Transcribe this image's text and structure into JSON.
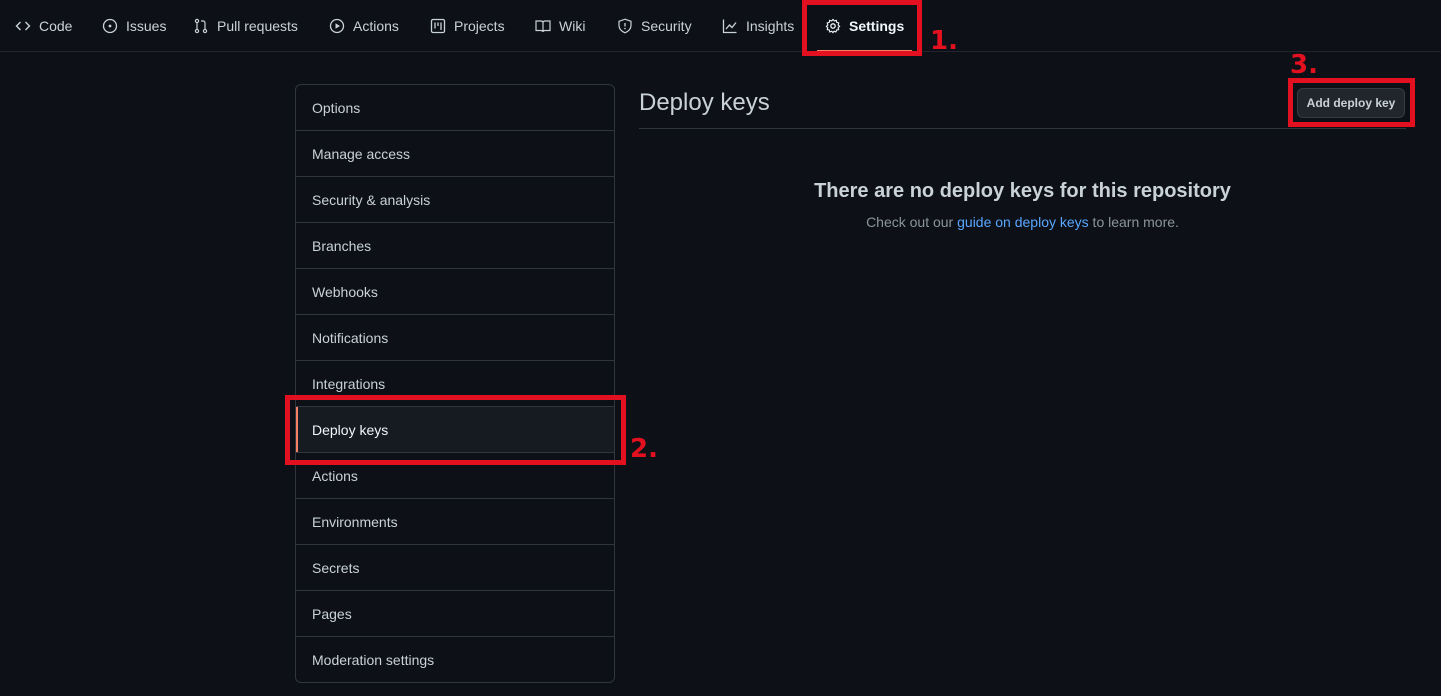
{
  "repo_nav": {
    "tabs": [
      {
        "label": "Code",
        "icon": "code-icon"
      },
      {
        "label": "Issues",
        "icon": "issue-opened-icon"
      },
      {
        "label": "Pull requests",
        "icon": "git-pull-request-icon"
      },
      {
        "label": "Actions",
        "icon": "play-icon"
      },
      {
        "label": "Projects",
        "icon": "project-icon"
      },
      {
        "label": "Wiki",
        "icon": "book-icon"
      },
      {
        "label": "Security",
        "icon": "shield-icon"
      },
      {
        "label": "Insights",
        "icon": "graph-icon"
      },
      {
        "label": "Settings",
        "icon": "gear-icon",
        "active": true
      }
    ]
  },
  "settings_menu": {
    "items": [
      {
        "label": "Options"
      },
      {
        "label": "Manage access"
      },
      {
        "label": "Security & analysis"
      },
      {
        "label": "Branches"
      },
      {
        "label": "Webhooks"
      },
      {
        "label": "Notifications"
      },
      {
        "label": "Integrations"
      },
      {
        "label": "Deploy keys",
        "selected": true
      },
      {
        "label": "Actions"
      },
      {
        "label": "Environments"
      },
      {
        "label": "Secrets"
      },
      {
        "label": "Pages"
      },
      {
        "label": "Moderation settings"
      }
    ]
  },
  "main": {
    "title": "Deploy keys",
    "add_button_label": "Add deploy key",
    "blankslate": {
      "title": "There are no deploy keys for this repository",
      "text_before": "Check out our ",
      "link_text": "guide on deploy keys",
      "text_after": " to learn more."
    }
  },
  "annotations": {
    "step1": "1.",
    "step2": "2.",
    "step3": "3."
  },
  "colors": {
    "background": "#0d1117",
    "highlight": "#e3101f",
    "link": "#58a6ff",
    "active_underline": "#f78166"
  }
}
